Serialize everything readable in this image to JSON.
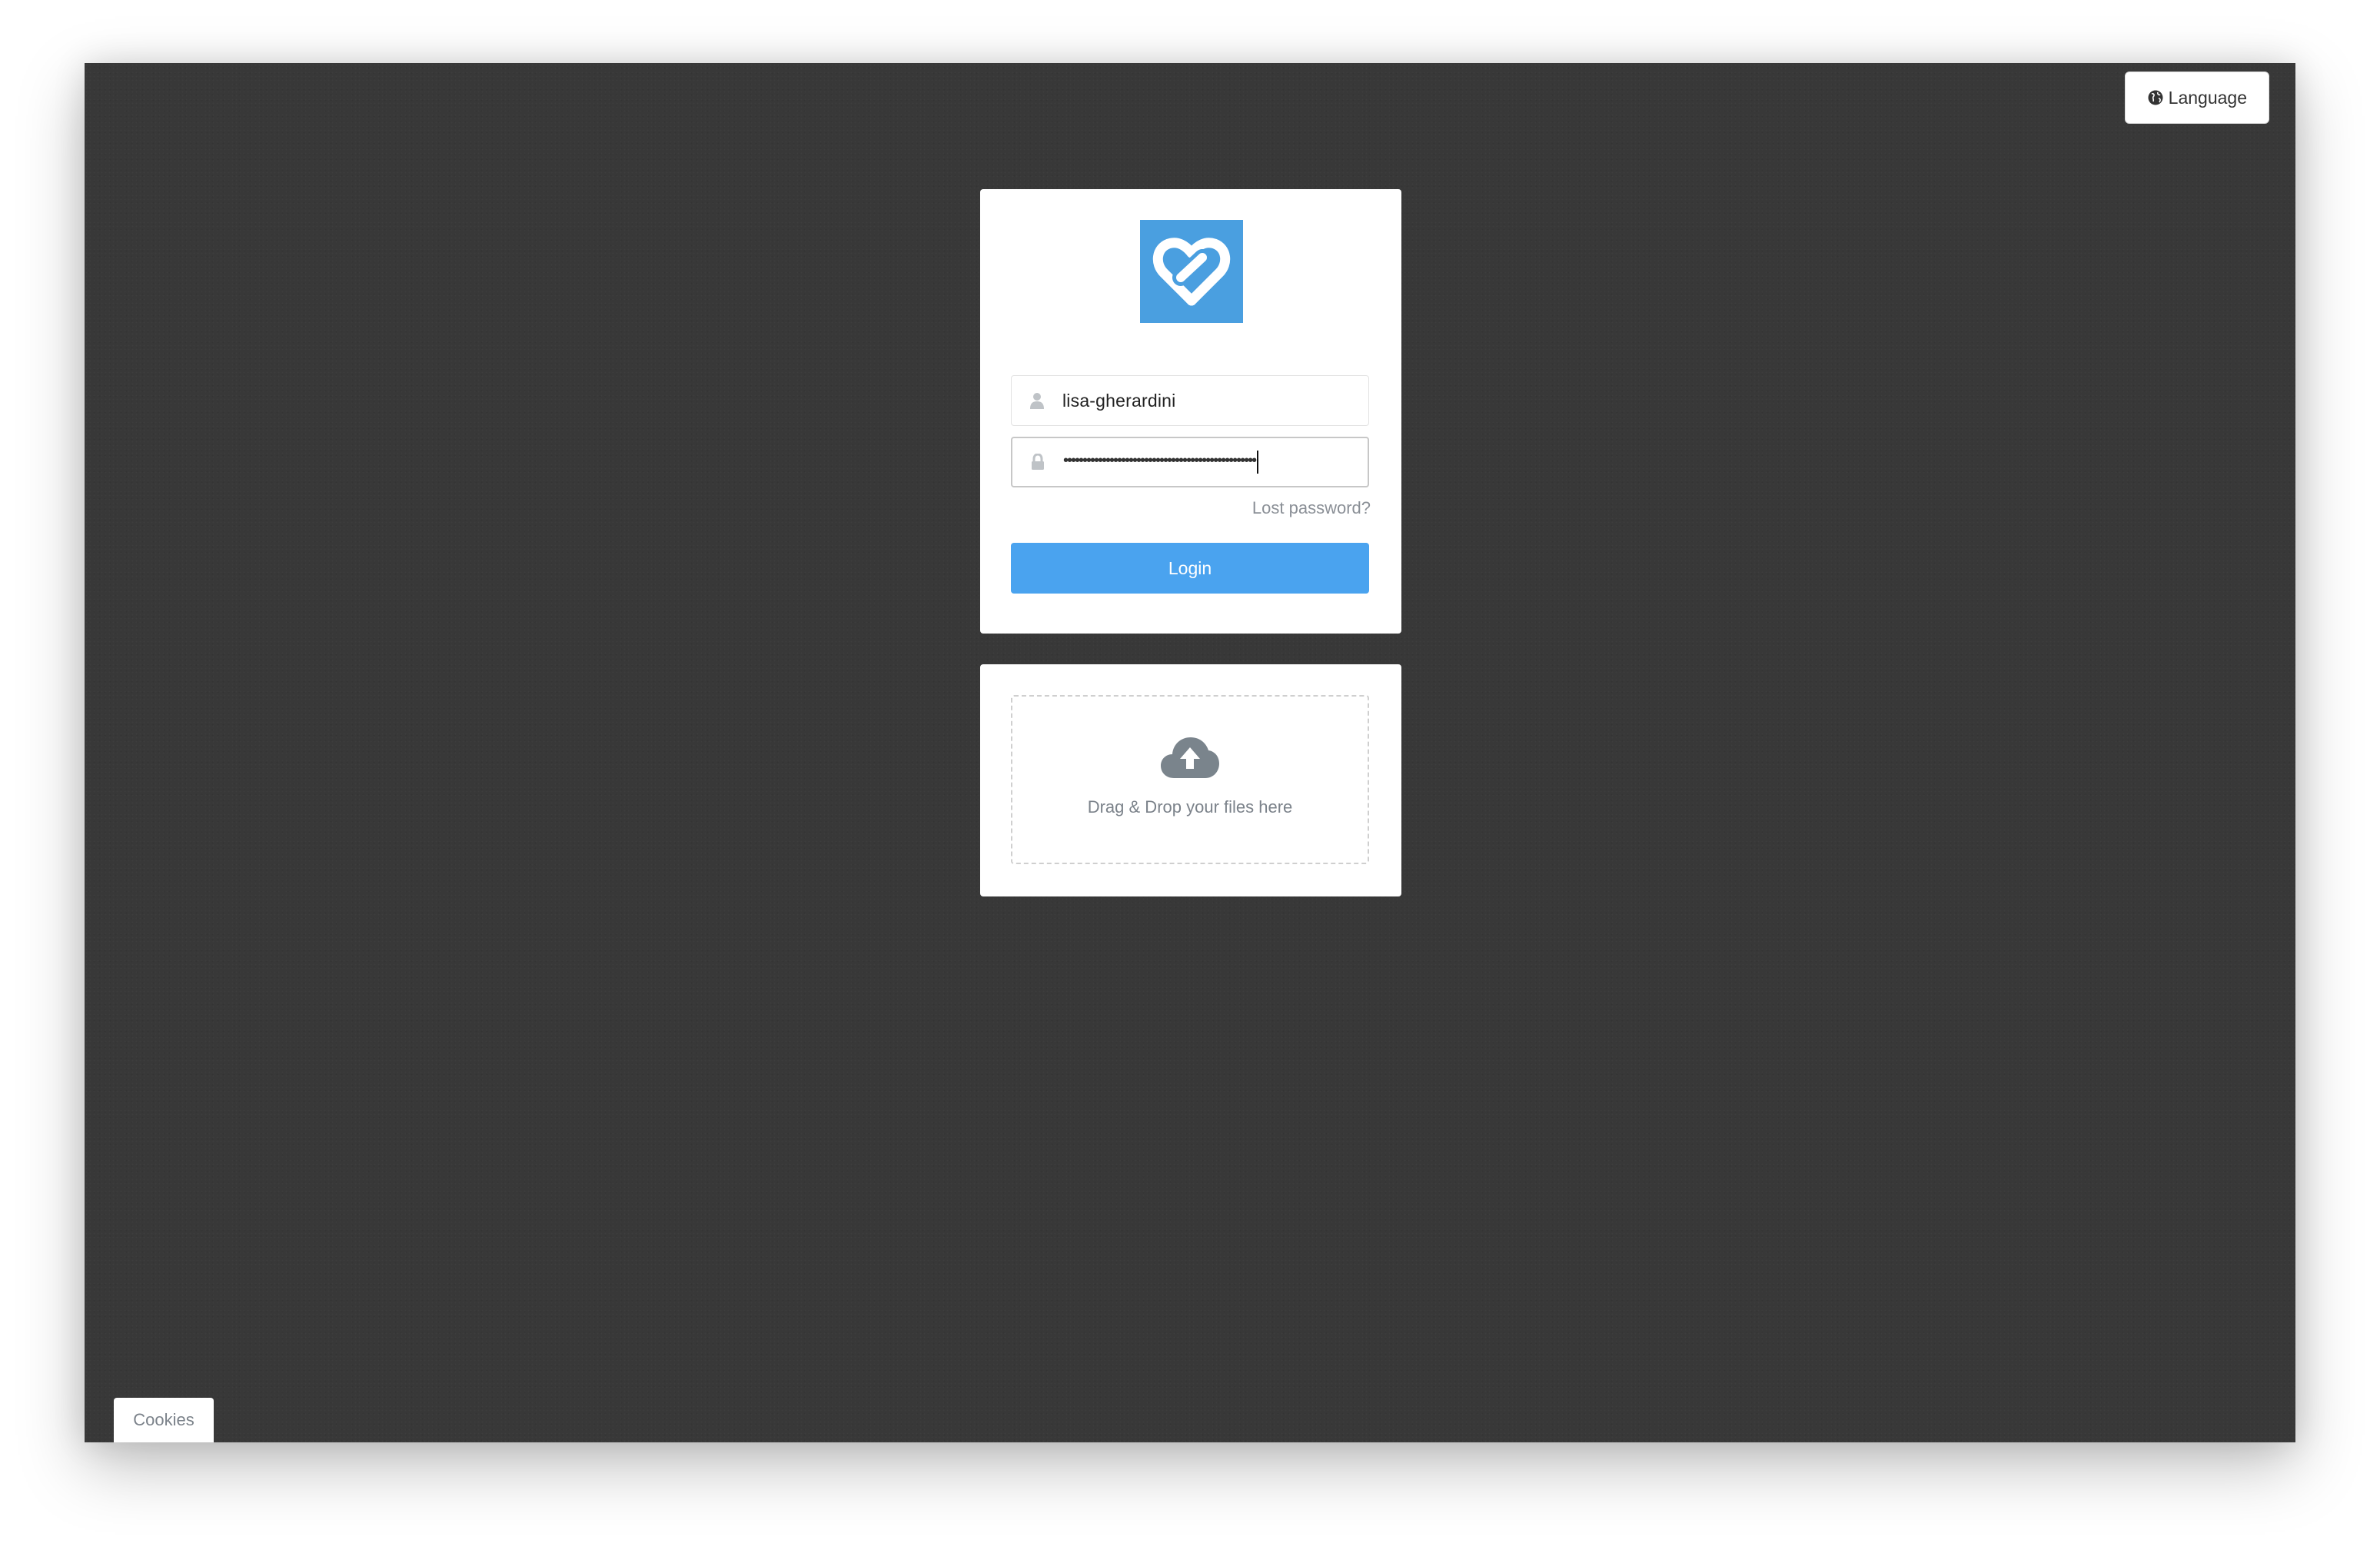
{
  "header": {
    "language_label": "Language",
    "language_icon": "globe-icon"
  },
  "login": {
    "logo_icon": "link-heart-logo",
    "username_icon": "user-icon",
    "username_value": "lisa-gherardini",
    "password_icon": "lock-icon",
    "password_mask": "••••••••••••••••••••••••••••••••••••••••••••••••••",
    "lost_password_label": "Lost password?",
    "login_button_label": "Login"
  },
  "upload": {
    "icon": "cloud-upload-icon",
    "dropzone_text": "Drag & Drop your files here"
  },
  "footer": {
    "cookies_label": "Cookies"
  },
  "colors": {
    "background": "#383838",
    "accent": "#4aa3ef",
    "logo": "#4a9fe0"
  }
}
